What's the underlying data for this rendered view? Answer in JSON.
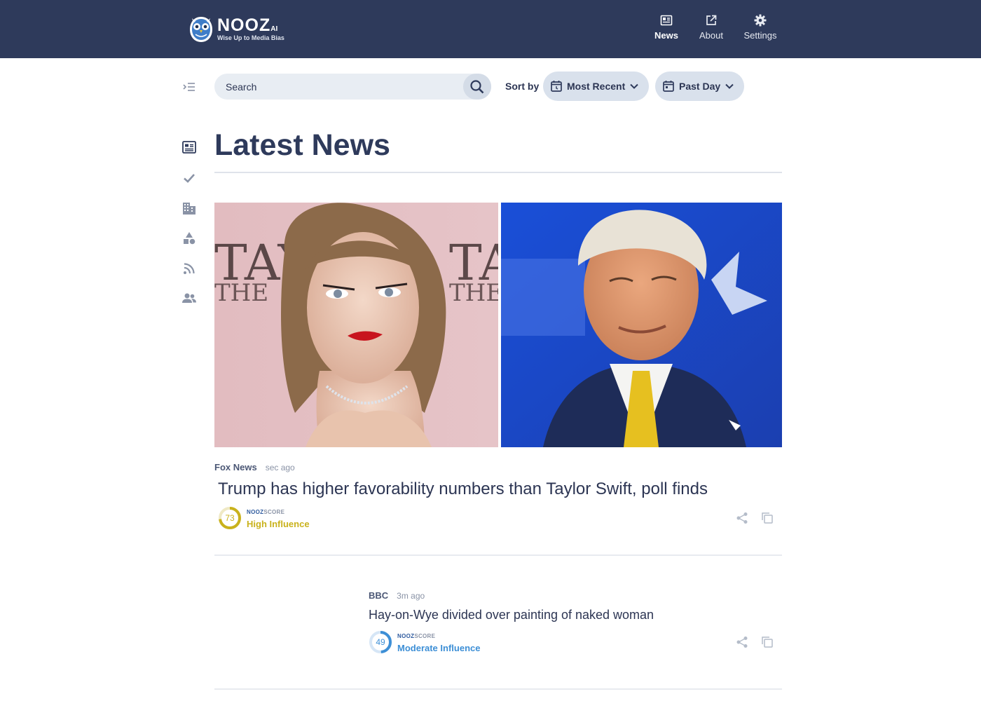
{
  "brand": {
    "name": "NOOZ",
    "suffix": "AI",
    "tagline": "Wise Up to Media Bias"
  },
  "nav": [
    {
      "label": "News",
      "icon": "newspaper-icon",
      "active": true
    },
    {
      "label": "About",
      "icon": "external-link-icon"
    },
    {
      "label": "Settings",
      "icon": "gear-icon"
    }
  ],
  "sidebar": [
    "menu-collapse-icon",
    "newspaper-icon",
    "check-icon",
    "building-icon",
    "categories-icon",
    "rss-icon",
    "people-icon"
  ],
  "search": {
    "placeholder": "Search"
  },
  "sort": {
    "label": "Sort by",
    "order": "Most Recent",
    "range": "Past Day"
  },
  "page": {
    "title": "Latest News"
  },
  "articles": [
    {
      "source": "Fox News",
      "time": "sec ago",
      "headline": "Trump has higher favorability numbers than Taylor Swift, poll finds",
      "score": {
        "brand": "NOOZ",
        "word": "SCORE",
        "value": "73",
        "influence": "High Influence",
        "color": "#c9b21c"
      }
    },
    {
      "source": "BBC",
      "time": "3m ago",
      "headline": "Hay-on-Wye divided over painting of naked woman",
      "score": {
        "brand": "NOOZ",
        "word": "SCORE",
        "value": "49",
        "influence": "Moderate Influence",
        "color": "#3d8fd6"
      }
    }
  ],
  "colors": {
    "header": "#2e3a5b",
    "accent_high": "#c9b21c",
    "accent_moderate": "#3d8fd6"
  }
}
